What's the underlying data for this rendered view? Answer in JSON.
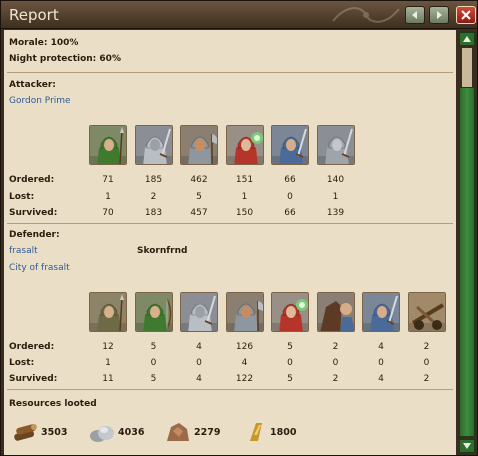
{
  "window": {
    "title": "Report"
  },
  "summary": {
    "morale_label": "Morale: 100%",
    "night_label": "Night protection: 60%"
  },
  "attacker": {
    "heading": "Attacker:",
    "player": "Gordon Prime",
    "units": [
      "spear-fighter",
      "swordsman",
      "axe-fighter",
      "mage",
      "light-cavalry",
      "paladin"
    ],
    "ordered": [
      "71",
      "185",
      "462",
      "151",
      "66",
      "140"
    ],
    "lost": [
      "1",
      "2",
      "5",
      "1",
      "0",
      "1"
    ],
    "survived": [
      "70",
      "183",
      "457",
      "150",
      "66",
      "139"
    ]
  },
  "defender": {
    "heading": "Defender:",
    "player": "frasalt",
    "village": "City of frasalt",
    "extra": "Skornfrnd",
    "units": [
      "spearman",
      "archer",
      "swordsman",
      "axe-fighter",
      "mage",
      "mounted-knight",
      "light-cavalry",
      "ballista"
    ],
    "ordered": [
      "12",
      "5",
      "4",
      "126",
      "5",
      "2",
      "4",
      "2"
    ],
    "lost": [
      "1",
      "0",
      "0",
      "4",
      "0",
      "0",
      "0",
      "0"
    ],
    "survived": [
      "11",
      "5",
      "4",
      "122",
      "5",
      "2",
      "4",
      "2"
    ]
  },
  "row_labels": {
    "ordered": "Ordered:",
    "lost": "Lost:",
    "survived": "Survived:"
  },
  "resources": {
    "heading": "Resources looted",
    "wood": "3503",
    "stone": "4036",
    "ore": "2279",
    "gold": "1800"
  },
  "colors": {
    "panel": "#eadfc6",
    "link": "#2f5b9a",
    "scroll": "#2f6d2f",
    "close": "#b12a1c"
  }
}
